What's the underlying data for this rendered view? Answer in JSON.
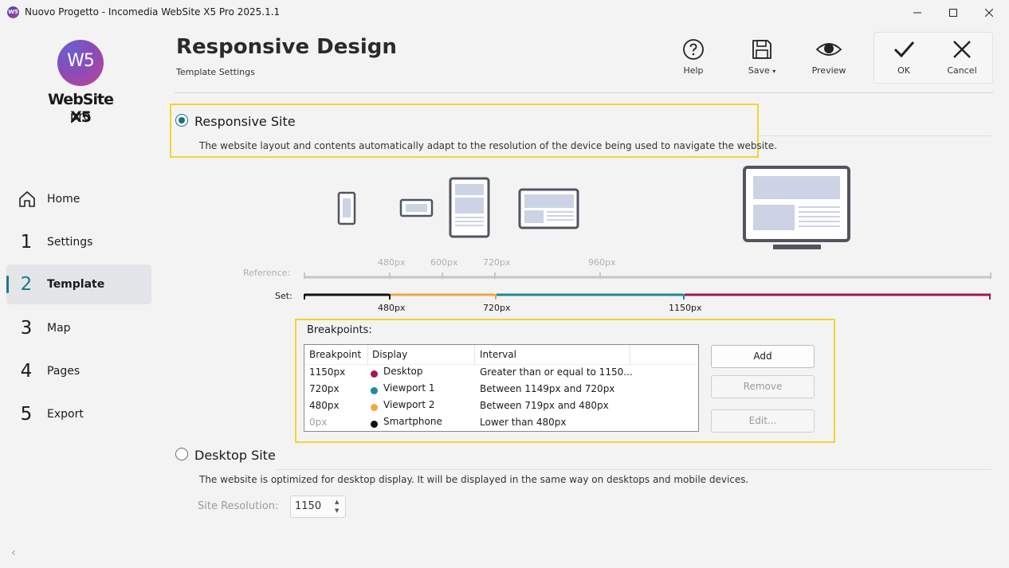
{
  "window": {
    "title": "Nuovo Progetto - Incomedia WebSite X5 Pro 2025.1.1",
    "app_icon": "W5"
  },
  "logo": {
    "mark": "W5",
    "brand": "WebSite X5",
    "edition": "pro"
  },
  "sidebar": {
    "items": [
      {
        "num": "",
        "label": "Home",
        "icon": "home-icon"
      },
      {
        "num": "1",
        "label": "Settings"
      },
      {
        "num": "2",
        "label": "Template",
        "active": true
      },
      {
        "num": "3",
        "label": "Map"
      },
      {
        "num": "4",
        "label": "Pages"
      },
      {
        "num": "5",
        "label": "Export"
      }
    ],
    "back_glyph": "‹"
  },
  "header": {
    "title": "Responsive Design",
    "subtitle": "Template Settings"
  },
  "toolbar": {
    "help": "Help",
    "save": "Save",
    "save_caret": "▾",
    "preview": "Preview",
    "ok": "OK",
    "cancel": "Cancel"
  },
  "responsive": {
    "label": "Responsive Site",
    "description": "The website layout and contents automatically adapt to the resolution of the device being used to navigate the website.",
    "selected": true
  },
  "scale": {
    "reference_label": "Reference:",
    "set_label": "Set:",
    "reference_ticks": [
      "480px",
      "600px",
      "720px",
      "960px"
    ],
    "set_ticks": [
      "480px",
      "720px",
      "1150px"
    ]
  },
  "breakpoints": {
    "title": "Breakpoints:",
    "columns": [
      "Breakpoint",
      "Display",
      "Interval"
    ],
    "rows": [
      {
        "breakpoint": "1150px",
        "display": "Desktop",
        "interval": "Greater than or equal to 1150...",
        "color": "#a0175a"
      },
      {
        "breakpoint": "720px",
        "display": "Viewport 1",
        "interval": "Between 1149px and 720px",
        "color": "#1f8a96"
      },
      {
        "breakpoint": "480px",
        "display": "Viewport 2",
        "interval": "Between 719px and 480px",
        "color": "#f0a747"
      },
      {
        "breakpoint": "0px",
        "display": "Smartphone",
        "interval": "Lower than 480px",
        "color": "#111111"
      }
    ],
    "buttons": {
      "add": "Add",
      "remove": "Remove",
      "edit": "Edit..."
    }
  },
  "desktop": {
    "label": "Desktop Site",
    "description": "The website is optimized for desktop display. It will be displayed in the same way on desktops and mobile devices.",
    "resolution_label": "Site Resolution:",
    "resolution_value": "1150",
    "spin_up": "▲",
    "spin_down": "▼",
    "selected": false
  },
  "colors": {
    "accent": "#1a6f80",
    "highlight": "#f2d431",
    "desktop": "#a0175a",
    "viewport1": "#1f8a96",
    "viewport2": "#f0a747",
    "smartphone": "#111111"
  }
}
